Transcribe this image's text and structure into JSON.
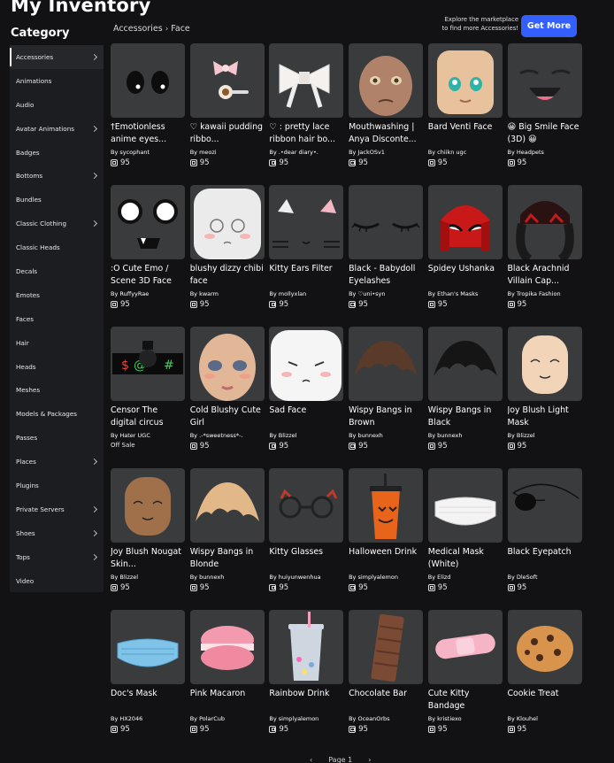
{
  "header": {
    "title": "My Inventory",
    "category_title": "Category"
  },
  "breadcrumb": [
    "Accessories",
    "Face"
  ],
  "promo": {
    "line1": "Explore the marketplace",
    "line2": "to find more Accessories!",
    "button": "Get More"
  },
  "colors": {
    "accent": "#335fff",
    "page_bg": "#121215",
    "card_bg": "#393b3d",
    "sidebar_bg": "#1c1d21"
  },
  "sidebar": {
    "items": [
      {
        "label": "Accessories",
        "chevron": true,
        "active": true
      },
      {
        "label": "Animations",
        "chevron": false
      },
      {
        "label": "Audio",
        "chevron": false
      },
      {
        "label": "Avatar Animations",
        "chevron": true
      },
      {
        "label": "Badges",
        "chevron": false
      },
      {
        "label": "Bottoms",
        "chevron": true
      },
      {
        "label": "Bundles",
        "chevron": false
      },
      {
        "label": "Classic Clothing",
        "chevron": true
      },
      {
        "label": "Classic Heads",
        "chevron": false
      },
      {
        "label": "Decals",
        "chevron": false
      },
      {
        "label": "Emotes",
        "chevron": false
      },
      {
        "label": "Faces",
        "chevron": false
      },
      {
        "label": "Hair",
        "chevron": false
      },
      {
        "label": "Heads",
        "chevron": false
      },
      {
        "label": "Meshes",
        "chevron": false
      },
      {
        "label": "Models & Packages",
        "chevron": false
      },
      {
        "label": "Passes",
        "chevron": false
      },
      {
        "label": "Places",
        "chevron": true
      },
      {
        "label": "Plugins",
        "chevron": false
      },
      {
        "label": "Private Servers",
        "chevron": true
      },
      {
        "label": "Shoes",
        "chevron": true
      },
      {
        "label": "Tops",
        "chevron": true
      },
      {
        "label": "Video",
        "chevron": false
      }
    ]
  },
  "items": [
    {
      "name": "†Emotionless anime eyes...",
      "creator": "sycophant",
      "price": "95",
      "icon": "anime-eyes"
    },
    {
      "name": "♡ kawaii pudding ribbo...",
      "creator": "meozi",
      "price": "95",
      "icon": "pudding-ribbon"
    },
    {
      "name": "♡ : pretty lace ribbon hair bo...",
      "creator": ".•dear diary•.",
      "price": "95",
      "icon": "lace-bow"
    },
    {
      "name": "Mouthwashing | Anya Disconte...",
      "creator": "JackOSv1",
      "price": "95",
      "icon": "anya-face"
    },
    {
      "name": "Bard Venti Face",
      "creator": "chiikn ugc",
      "price": "95",
      "icon": "venti-face"
    },
    {
      "name": "😀 Big Smile Face (3D) 😀",
      "creator": "Headpets",
      "price": "95",
      "icon": "big-smile"
    },
    {
      "name": ":O Cute Emo / Scene 3D Face",
      "creator": "RuffyyRae",
      "price": "95",
      "icon": "emo-face"
    },
    {
      "name": "blushy dizzy chibi face",
      "creator": "kwarm",
      "price": "95",
      "icon": "dizzy-head"
    },
    {
      "name": "Kitty Ears Filter",
      "creator": "mollyxlan",
      "price": "95",
      "icon": "kitty-ears"
    },
    {
      "name": "Black - Babydoll Eyelashes",
      "creator": "♡uni•syn",
      "price": "95",
      "icon": "eyelashes"
    },
    {
      "name": "Spidey Ushanka",
      "creator": "Ethan's Masks",
      "price": "95",
      "icon": "spidey-hat"
    },
    {
      "name": "Black Arachnid Villain Cap...",
      "creator": "Tropika Fashion",
      "price": "95",
      "icon": "arachnid-cap"
    },
    {
      "name": "Censor The digital circus",
      "creator": "Hater UGC",
      "price": "",
      "offsale": "Off Sale",
      "icon": "censor-bar"
    },
    {
      "name": "Cold Blushy Cute Girl",
      "creator": ".-*sweetness*-.",
      "price": "95",
      "icon": "girl-face"
    },
    {
      "name": "Sad Face",
      "creator": "Blizzel",
      "price": "95",
      "icon": "sad-head"
    },
    {
      "name": "Wispy Bangs in Brown",
      "creator": "bunnexh",
      "price": "95",
      "icon": "bangs-brown"
    },
    {
      "name": "Wispy Bangs in Black",
      "creator": "bunnexh",
      "price": "95",
      "icon": "bangs-black"
    },
    {
      "name": "Joy Blush Light Mask",
      "creator": "Blizzel",
      "price": "95",
      "icon": "joy-light"
    },
    {
      "name": "Joy Blush Nougat Skin...",
      "creator": "Blizzel",
      "price": "95",
      "icon": "joy-nougat"
    },
    {
      "name": "Wispy Bangs in Blonde",
      "creator": "bunnexh",
      "price": "95",
      "icon": "bangs-blonde"
    },
    {
      "name": "Kitty Glasses",
      "creator": "huiyunwenhua",
      "price": "95",
      "icon": "kitty-glasses"
    },
    {
      "name": "Halloween Drink",
      "creator": "simplyalemon",
      "price": "95",
      "icon": "halloween-drink"
    },
    {
      "name": "Medical Mask (White)",
      "creator": "Elizd",
      "price": "95",
      "icon": "mask-white"
    },
    {
      "name": "Black Eyepatch",
      "creator": "DleSoft",
      "price": "95",
      "icon": "eyepatch"
    },
    {
      "name": "Doc's Mask",
      "creator": "HX2046",
      "price": "95",
      "icon": "mask-blue"
    },
    {
      "name": "Pink Macaron",
      "creator": "PolarCub",
      "price": "95",
      "icon": "macaron"
    },
    {
      "name": "Rainbow Drink",
      "creator": "simplyalemon",
      "price": "95",
      "icon": "rainbow-drink"
    },
    {
      "name": "Chocolate Bar",
      "creator": "OceanOrbs",
      "price": "95",
      "icon": "chocolate"
    },
    {
      "name": "Cute Kitty Bandage",
      "creator": "kristiexo",
      "price": "95",
      "icon": "bandage"
    },
    {
      "name": "Cookie Treat",
      "creator": "Klouhel",
      "price": "95",
      "icon": "cookie"
    }
  ],
  "pagination": {
    "label": "Page 1"
  }
}
